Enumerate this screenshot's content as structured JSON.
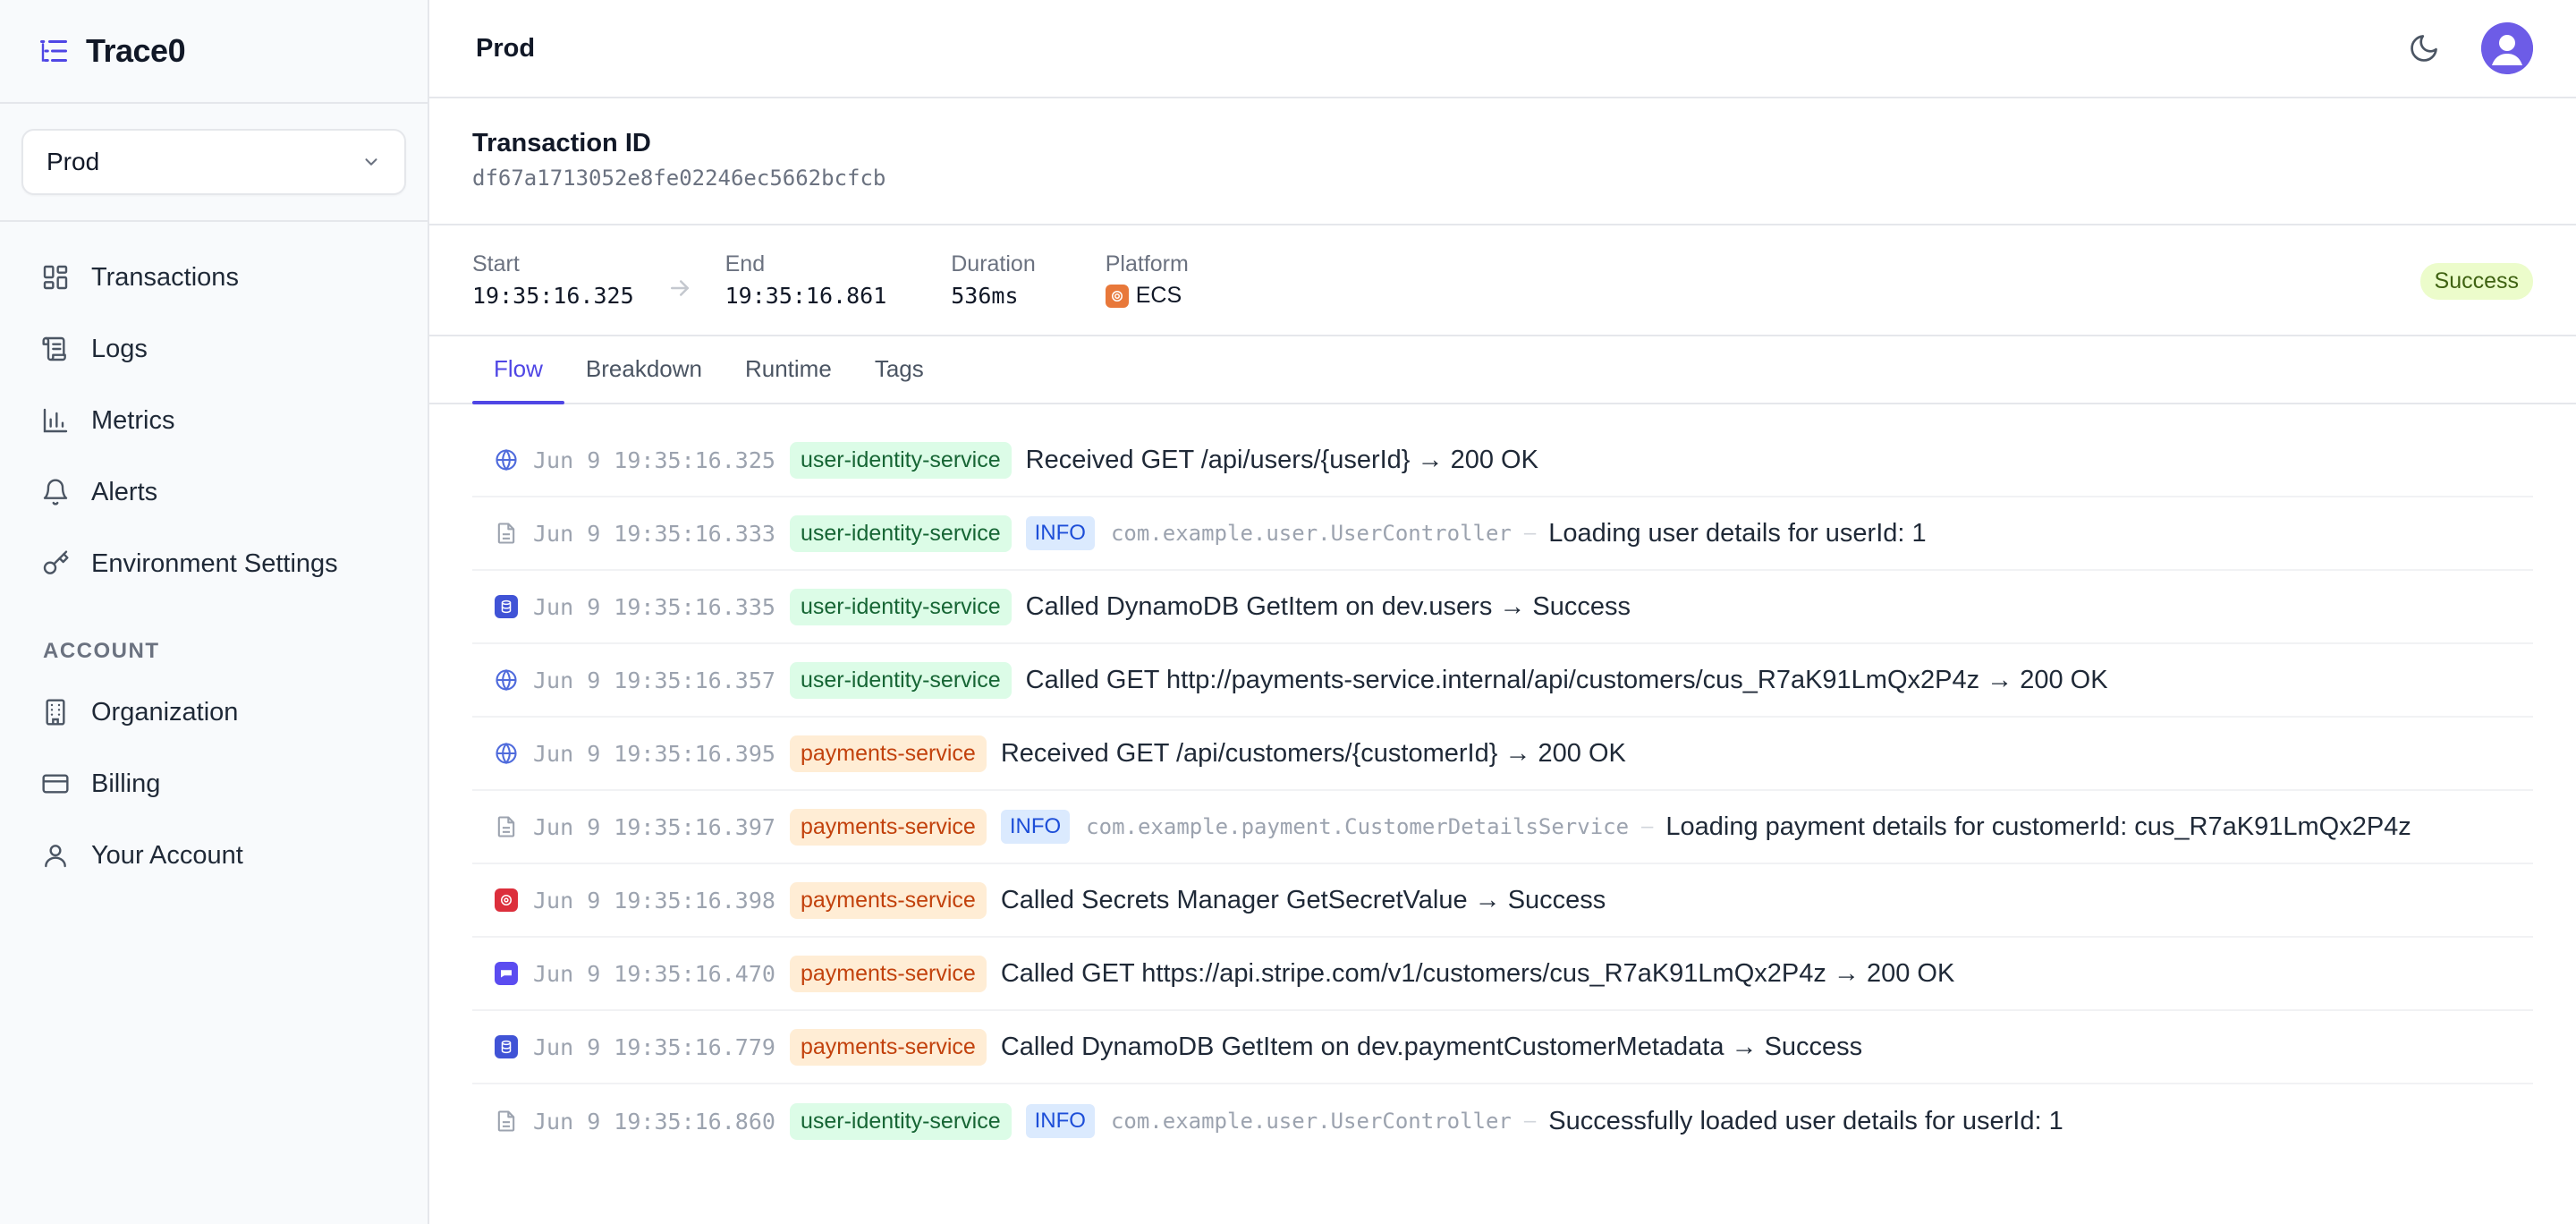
{
  "app": {
    "name": "Trace0"
  },
  "sidebar": {
    "env_select": {
      "value": "Prod"
    },
    "nav": [
      {
        "label": "Transactions",
        "icon": "grid-icon"
      },
      {
        "label": "Logs",
        "icon": "scroll-icon"
      },
      {
        "label": "Metrics",
        "icon": "bar-chart-icon"
      },
      {
        "label": "Alerts",
        "icon": "bell-icon"
      },
      {
        "label": "Environment Settings",
        "icon": "key-icon"
      }
    ],
    "account_section": "ACCOUNT",
    "account_nav": [
      {
        "label": "Organization",
        "icon": "building-icon"
      },
      {
        "label": "Billing",
        "icon": "credit-card-icon"
      },
      {
        "label": "Your Account",
        "icon": "user-icon"
      }
    ]
  },
  "header": {
    "crumb": "Prod"
  },
  "transaction": {
    "label": "Transaction ID",
    "id": "df67a1713052e8fe02246ec5662bcfcb",
    "start_label": "Start",
    "start": "19:35:16.325",
    "end_label": "End",
    "end": "19:35:16.861",
    "duration_label": "Duration",
    "duration": "536ms",
    "platform_label": "Platform",
    "platform": "ECS",
    "status": "Success"
  },
  "tabs": [
    "Flow",
    "Breakdown",
    "Runtime",
    "Tags"
  ],
  "colors": {
    "accent": "#4f46e5",
    "service_green_bg": "#dcfce7",
    "service_orange_bg": "#ffedd5",
    "success_bg": "#ecfccb"
  },
  "flow": [
    {
      "icon": "globe-icon",
      "ts": "Jun 9 19:35:16.325",
      "service": "user-identity-service",
      "tone": "green",
      "message": "Received GET /api/users/{userId} → 200 OK"
    },
    {
      "icon": "document-icon",
      "ts": "Jun 9 19:35:16.333",
      "service": "user-identity-service",
      "tone": "green",
      "level": "INFO",
      "logger": "com.example.user.UserController",
      "message": "Loading user details for userId: 1"
    },
    {
      "icon": "dynamodb-icon",
      "ts": "Jun 9 19:35:16.335",
      "service": "user-identity-service",
      "tone": "green",
      "message": "Called DynamoDB GetItem on dev.users → Success"
    },
    {
      "icon": "globe-icon",
      "ts": "Jun 9 19:35:16.357",
      "service": "user-identity-service",
      "tone": "green",
      "message": "Called GET http://payments-service.internal/api/customers/cus_R7aK91LmQx2P4z → 200 OK"
    },
    {
      "icon": "globe-icon",
      "ts": "Jun 9 19:35:16.395",
      "service": "payments-service",
      "tone": "orange",
      "message": "Received GET /api/customers/{customerId} → 200 OK"
    },
    {
      "icon": "document-icon",
      "ts": "Jun 9 19:35:16.397",
      "service": "payments-service",
      "tone": "orange",
      "level": "INFO",
      "logger": "com.example.payment.CustomerDetailsService",
      "message": "Loading payment details for customerId: cus_R7aK91LmQx2P4z"
    },
    {
      "icon": "secrets-manager-icon",
      "ts": "Jun 9 19:35:16.398",
      "service": "payments-service",
      "tone": "orange",
      "message": "Called Secrets Manager GetSecretValue → Success"
    },
    {
      "icon": "stripe-icon",
      "ts": "Jun 9 19:35:16.470",
      "service": "payments-service",
      "tone": "orange",
      "message": "Called GET https://api.stripe.com/v1/customers/cus_R7aK91LmQx2P4z → 200 OK"
    },
    {
      "icon": "dynamodb-icon",
      "ts": "Jun 9 19:35:16.779",
      "service": "payments-service",
      "tone": "orange",
      "message": "Called DynamoDB GetItem on dev.paymentCustomerMetadata → Success"
    },
    {
      "icon": "document-icon",
      "ts": "Jun 9 19:35:16.860",
      "service": "user-identity-service",
      "tone": "green",
      "level": "INFO",
      "logger": "com.example.user.UserController",
      "message": "Successfully loaded user details for userId: 1"
    }
  ]
}
